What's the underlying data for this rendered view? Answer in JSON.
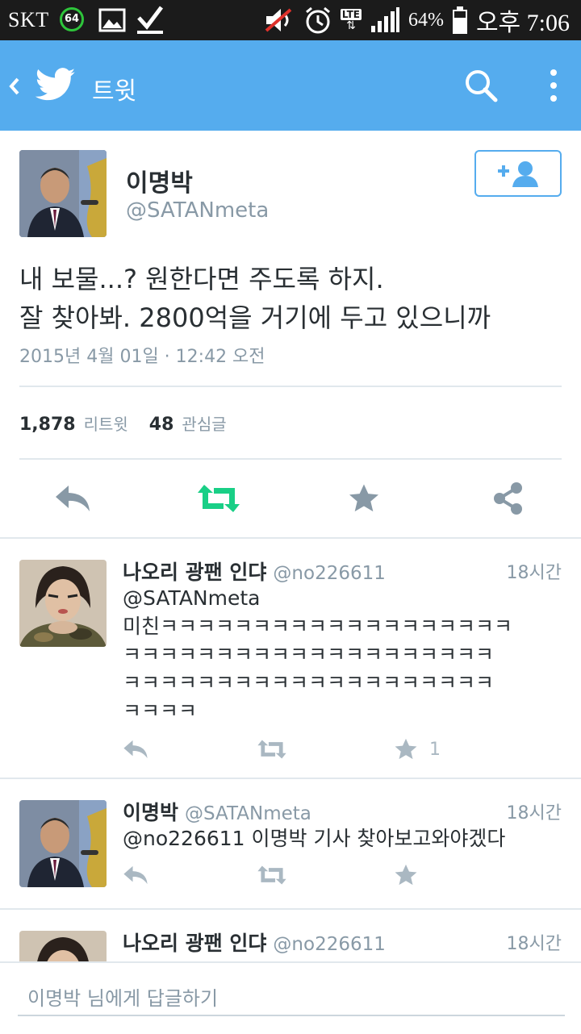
{
  "status_bar": {
    "carrier": "SKT",
    "badge": "64",
    "battery_pct": "64%",
    "time": "오후 7:06",
    "lte": "LTE"
  },
  "app_bar": {
    "title": "트윗"
  },
  "tweet": {
    "author_name": "이명박",
    "author_handle": "@SATANmeta",
    "text_line1": "내 보물...? 원한다면 주도록 하지.",
    "text_line2": "잘 찾아봐. 2800억을 거기에 두고 있으니까",
    "date": "2015년 4월 01일 · 12:42 오전",
    "retweets_count": "1,878",
    "retweets_label": "리트윗",
    "favorites_count": "48",
    "favorites_label": "관심글"
  },
  "replies": [
    {
      "name": "나오리 광팬 인댜",
      "handle": "@no226611",
      "time": "18시간",
      "text": "@SATANmeta 미친ㅋㅋㅋㅋㅋㅋㅋㅋㅋㅋㅋㅋㅋㅋㅋㅋㅋㅋㅋㅋㅋㅋㅋㅋㅋㅋㅋㅋㅋㅋㅋㅋㅋㅋㅋㅋㅋㅋㅋㅋㅋㅋㅋㅋㅋㅋㅋㅋㅋㅋㅋㅋㅋㅋㅋㅋㅋㅋ",
      "text_mention": "@SATANmeta",
      "text_line1": "미친ㅋㅋㅋㅋㅋㅋㅋㅋㅋㅋㅋㅋㅋㅋㅋㅋㅋㅋㅋ",
      "text_line2": "ㅋㅋㅋㅋㅋㅋㅋㅋㅋㅋㅋㅋㅋㅋㅋㅋㅋㅋㅋㅋ",
      "text_line3": "ㅋㅋㅋㅋㅋㅋㅋㅋㅋㅋㅋㅋㅋㅋㅋㅋㅋㅋㅋㅋ",
      "text_line4": "ㅋㅋㅋㅋ",
      "favorite_count": "1"
    },
    {
      "name": "이명박",
      "handle": "@SATANmeta",
      "time": "18시간",
      "text": "@no226611 이명박 기사 찾아보고와야겠다"
    },
    {
      "name": "나오리 광팬 인댜",
      "handle": "@no226611",
      "time": "18시간"
    }
  ],
  "reply_box": {
    "placeholder": "이명박 님에게 답글하기"
  },
  "colors": {
    "twitter_blue": "#55acee",
    "retweet_green": "#19cf86",
    "icon_gray": "#8899a6"
  }
}
